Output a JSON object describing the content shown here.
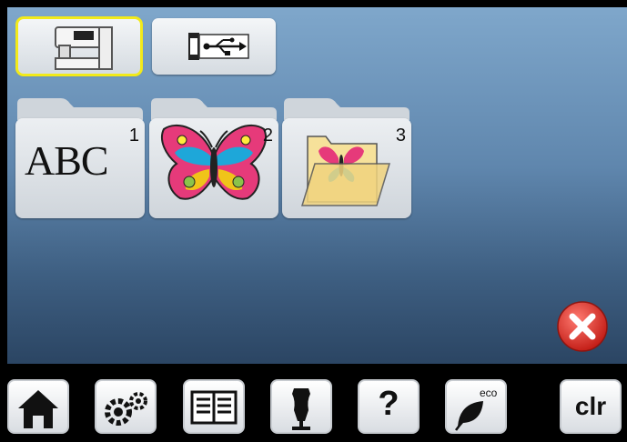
{
  "sources": [
    {
      "id": "machine",
      "icon": "sewing-machine-icon",
      "selected": true
    },
    {
      "id": "usb",
      "icon": "usb-icon",
      "selected": false
    }
  ],
  "folders": [
    {
      "number": "1",
      "label": "ABC",
      "icon": "alphabets-icon"
    },
    {
      "number": "2",
      "label": "",
      "icon": "butterfly-embroidery-icon"
    },
    {
      "number": "3",
      "label": "",
      "icon": "personal-folder-icon"
    }
  ],
  "close": {
    "icon": "close-icon",
    "color": "#d9322b"
  },
  "toolbar": {
    "home_icon": "home-icon",
    "setup_icon": "gears-icon",
    "tutorial_icon": "book-icon",
    "design_icon": "dress-form-icon",
    "help_label": "?",
    "eco_label": "eco",
    "clr_label": "clr"
  },
  "colors": {
    "selection": "#f2ea1a",
    "screen_top": "#7fa7cb",
    "screen_bottom": "#2b4563"
  }
}
